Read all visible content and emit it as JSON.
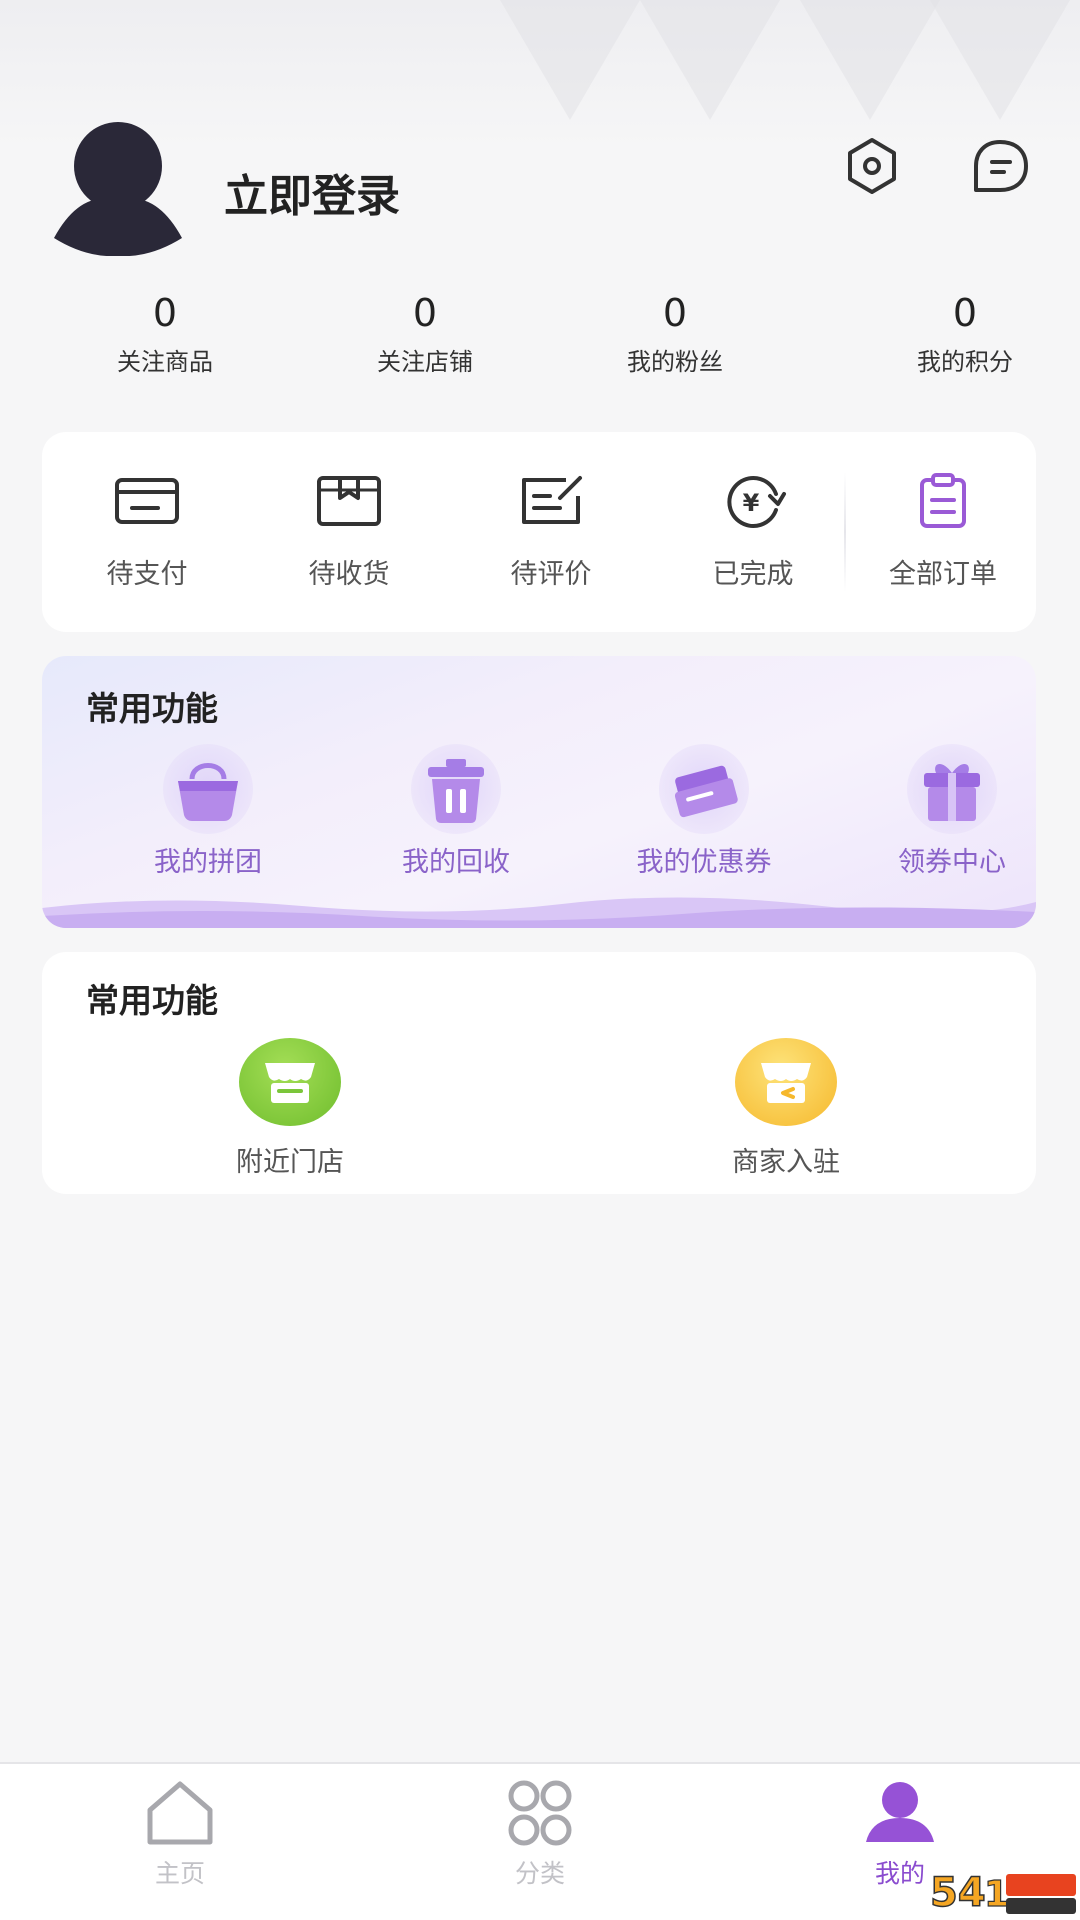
{
  "header": {
    "login_text": "立即登录",
    "settings_icon": "settings-hex-icon",
    "message_icon": "chat-bubble-icon"
  },
  "stats": [
    {
      "value": "0",
      "label": "关注商品"
    },
    {
      "value": "0",
      "label": "关注店铺"
    },
    {
      "value": "0",
      "label": "我的粉丝"
    },
    {
      "value": "0",
      "label": "我的积分"
    }
  ],
  "orders": [
    {
      "label": "待支付",
      "icon": "card-icon"
    },
    {
      "label": "待收货",
      "icon": "box-icon"
    },
    {
      "label": "待评价",
      "icon": "edit-note-icon"
    },
    {
      "label": "已完成",
      "icon": "yen-refresh-icon"
    },
    {
      "label": "全部订单",
      "icon": "clipboard-icon"
    }
  ],
  "common1": {
    "title": "常用功能",
    "items": [
      {
        "label": "我的拼团",
        "icon": "bag-icon"
      },
      {
        "label": "我的回收",
        "icon": "trash-icon"
      },
      {
        "label": "我的优惠券",
        "icon": "ticket-icon"
      },
      {
        "label": "领券中心",
        "icon": "gift-icon"
      }
    ]
  },
  "common2": {
    "title": "常用功能",
    "items": [
      {
        "label": "附近门店",
        "icon": "store-icon",
        "color": "#7bc63a"
      },
      {
        "label": "商家入驻",
        "icon": "shop-enter-icon",
        "color": "#f9c53c"
      }
    ]
  },
  "nav": [
    {
      "label": "主页",
      "icon": "home-icon",
      "active": false
    },
    {
      "label": "分类",
      "icon": "category-icon",
      "active": false
    },
    {
      "label": "我的",
      "icon": "user-icon",
      "active": true
    }
  ],
  "colors": {
    "accent": "#8a4ccf",
    "purple_light": "#b890ee"
  }
}
